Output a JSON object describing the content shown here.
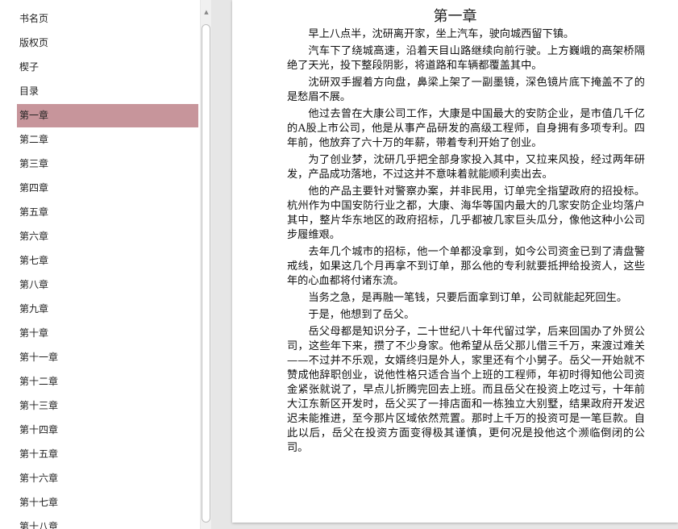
{
  "toc": [
    {
      "label": "书名页"
    },
    {
      "label": "版权页"
    },
    {
      "label": "楔子"
    },
    {
      "label": "目录"
    },
    {
      "label": "第一章",
      "active": true
    },
    {
      "label": "第二章"
    },
    {
      "label": "第三章"
    },
    {
      "label": "第四章"
    },
    {
      "label": "第五章"
    },
    {
      "label": "第六章"
    },
    {
      "label": "第七章"
    },
    {
      "label": "第八章"
    },
    {
      "label": "第九章"
    },
    {
      "label": "第十章"
    },
    {
      "label": "第十一章"
    },
    {
      "label": "第十二章"
    },
    {
      "label": "第十三章"
    },
    {
      "label": "第十四章"
    },
    {
      "label": "第十五章"
    },
    {
      "label": "第十六章"
    },
    {
      "label": "第十七章"
    },
    {
      "label": "第十八章"
    }
  ],
  "colors": {
    "active_item": "#c7959b",
    "viewer_bg": "#e6e6e6"
  },
  "scrollbar": {
    "up_arrow": "▲"
  },
  "chapter": {
    "title": "第一章",
    "paragraphs": [
      "早上八点半，沈研离开家，坐上汽车，驶向城西留下镇。",
      "汽车下了绕城高速，沿着天目山路继续向前行驶。上方巍峨的高架桥隔绝了天光，投下整段阴影，将道路和车辆都覆盖其中。",
      "沈研双手握着方向盘，鼻梁上架了一副墨镜，深色镜片底下掩盖不了的是愁眉不展。",
      "他过去曾在大康公司工作，大康是中国最大的安防企业，是市值几千亿的A股上市公司，他是从事产品研发的高级工程师，自身拥有多项专利。四年前，他放弃了六十万的年薪，带着专利开始了创业。",
      "为了创业梦，沈研几乎把全部身家投入其中，又拉来风投，经过两年研发，产品成功落地，不过这并不意味着就能顺利卖出去。",
      "他的产品主要针对警察办案，并非民用，订单完全指望政府的招投标。杭州作为中国安防行业之都，大康、海华等国内最大的几家安防企业均落户其中，整片华东地区的政府招标，几乎都被几家巨头瓜分，像他这种小公司步履维艰。",
      "去年几个城市的招标，他一个单都没拿到，如今公司资金已到了清盘警戒线，如果这几个月再拿不到订单，那么他的专利就要抵押给投资人，这些年的心血都将付诸东流。",
      "当务之急，是再融一笔钱，只要后面拿到订单，公司就能起死回生。",
      "于是，他想到了岳父。",
      "岳父母都是知识分子，二十世纪八十年代留过学，后来回国办了外贸公司，这些年下来，攒了不少身家。他希望从岳父那儿借三千万，来渡过难关——不过并不乐观，女婿终归是外人，家里还有个小舅子。岳父一开始就不赞成他辞职创业，说他性格只适合当个上班的工程师，年初时得知他公司资金紧张就说了，早点儿折腾完回去上班。而且岳父在投资上吃过亏，十年前大江东新区开发时，岳父买了一排店面和一栋独立大别墅，结果政府开发迟迟未能推进，至今那片区域依然荒置。那时上千万的投资可是一笔巨款。自此以后，岳父在投资方面变得极其谨慎，更何况是投他这个濒临倒闭的公司。"
    ]
  }
}
